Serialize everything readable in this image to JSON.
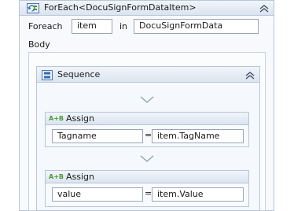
{
  "foreach": {
    "title": "ForEach<DocuSignFormDataItem>",
    "foreach_label": "Foreach",
    "item_value": "item",
    "in_label": "in",
    "collection_value": "DocuSignFormData",
    "body_label": "Body"
  },
  "sequence": {
    "title": "Sequence"
  },
  "assigns": [
    {
      "title": "Assign",
      "icon_text": "A+B",
      "to_value": "Tagname",
      "operator": "=",
      "value_expr": "item.TagName"
    },
    {
      "title": "Assign",
      "icon_text": "A+B",
      "to_value": "value",
      "operator": "=",
      "value_expr": "item.Value"
    }
  ],
  "colors": {
    "header_gradient_top": "#f1f5fa",
    "header_gradient_bottom": "#dbe4ef",
    "border": "#b8c6d8",
    "icon_green": "#4a9a3a"
  },
  "icons": [
    "foreach-activity-icon",
    "sequence-icon",
    "assign-icon",
    "collapse-icon",
    "drop-arrow-icon"
  ]
}
